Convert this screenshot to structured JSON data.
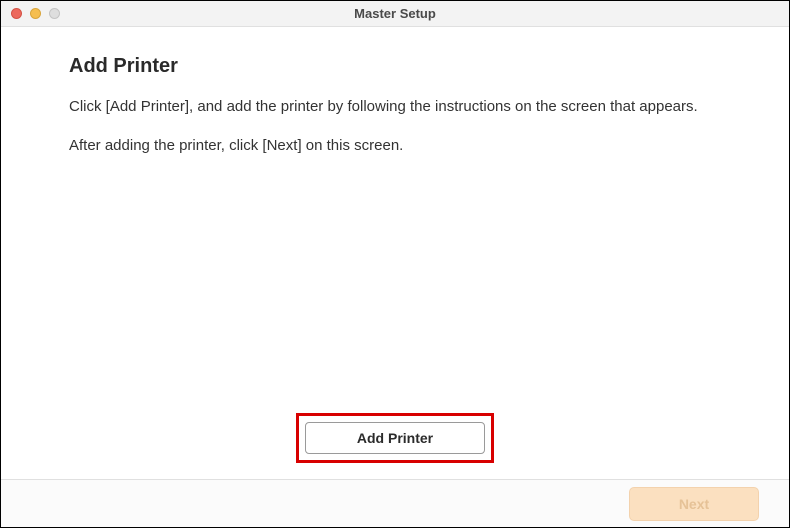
{
  "window": {
    "title": "Master Setup"
  },
  "content": {
    "heading": "Add Printer",
    "para1": "Click [Add Printer], and add the printer by following the instructions on the screen that appears.",
    "para2": "After adding the printer, click [Next] on this screen."
  },
  "buttons": {
    "add_printer": "Add Printer",
    "next": "Next"
  }
}
